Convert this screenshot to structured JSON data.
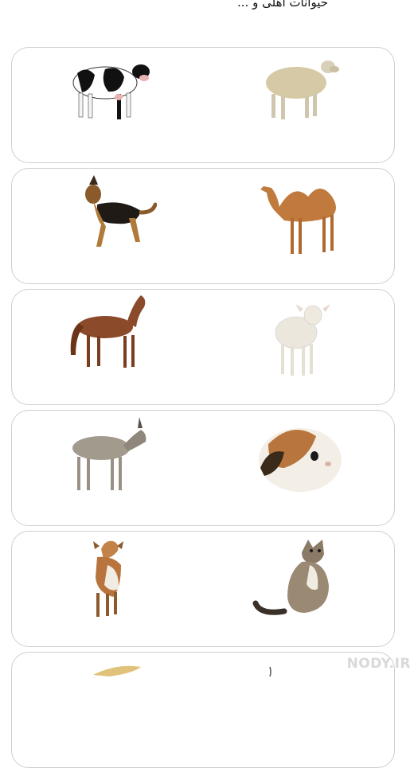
{
  "header": {
    "title": "حیوانات اهلی و ..."
  },
  "rows": [
    {
      "left": {
        "label": "Cow",
        "icon": "cow-icon"
      },
      "right": {
        "label": "Sheep",
        "icon": "sheep-icon"
      }
    },
    {
      "left": {
        "label": "Dog",
        "icon": "dog-icon"
      },
      "right": {
        "label": "Camel",
        "icon": "camel-icon"
      }
    },
    {
      "left": {
        "label": "Horse",
        "icon": "horse-icon"
      },
      "right": {
        "label": "Lamb",
        "icon": "lamb-icon"
      }
    },
    {
      "left": {
        "label": "Donkey",
        "icon": "donkey-icon"
      },
      "right": {
        "label": "Guinea pig",
        "icon": "guinea-pig-icon"
      }
    },
    {
      "left": {
        "label": "Goat",
        "icon": "goat-icon"
      },
      "right": {
        "label": "Cat",
        "icon": "cat-icon"
      }
    }
  ],
  "watermark": {
    "brand": "NODY.IR",
    "tagline": ""
  }
}
